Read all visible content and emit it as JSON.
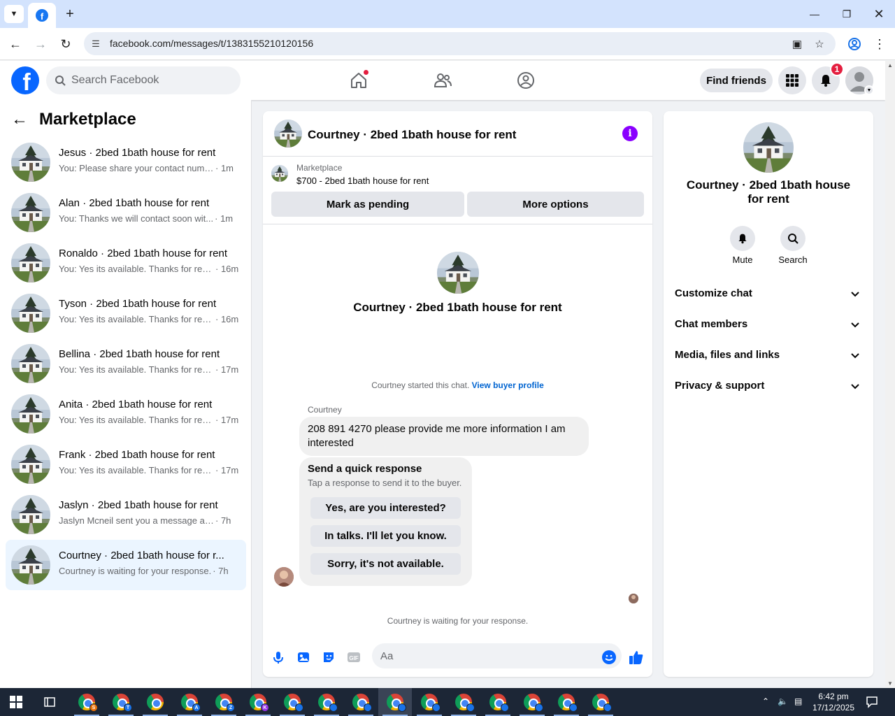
{
  "browser": {
    "url": "facebook.com/messages/t/1383155210120156"
  },
  "header": {
    "search_placeholder": "Search Facebook",
    "find_friends_label": "Find friends",
    "notification_count": "1"
  },
  "sidebar": {
    "title": "Marketplace",
    "conversations": [
      {
        "title": "Jesus · 2bed 1bath house for rent",
        "snippet": "You: Please share your contact numb...",
        "time": "· 1m",
        "active": false
      },
      {
        "title": "Alan · 2bed 1bath house for rent",
        "snippet": "You: Thanks we will contact soon wit...",
        "time": "· 1m",
        "active": false
      },
      {
        "title": "Ronaldo · 2bed 1bath house for rent",
        "snippet": "You: Yes its available. Thanks for rea...",
        "time": "· 16m",
        "active": false
      },
      {
        "title": "Tyson · 2bed 1bath house for rent",
        "snippet": "You: Yes its available. Thanks for rea...",
        "time": "· 16m",
        "active": false
      },
      {
        "title": "Bellina · 2bed 1bath house for rent",
        "snippet": "You: Yes its available. Thanks for rea...",
        "time": "· 17m",
        "active": false
      },
      {
        "title": "Anita · 2bed 1bath house for rent",
        "snippet": "You: Yes its available. Thanks for rea...",
        "time": "· 17m",
        "active": false
      },
      {
        "title": "Frank · 2bed 1bath house for rent",
        "snippet": "You: Yes its available. Thanks for rea...",
        "time": "· 17m",
        "active": false
      },
      {
        "title": "Jaslyn · 2bed 1bath house for rent",
        "snippet": "Jaslyn Mcneil sent you a message abo...",
        "time": "· 7h",
        "active": false
      },
      {
        "title": "Courtney · 2bed 1bath house for r...",
        "snippet": "Courtney is waiting for your response.",
        "time": "· 7h",
        "active": true
      }
    ]
  },
  "chat": {
    "title": "Courtney · 2bed 1bath house for rent",
    "listing_label": "Marketplace",
    "listing_desc": "$700 - 2bed 1bath house for rent",
    "mark_pending_label": "Mark as pending",
    "more_options_label": "More options",
    "intro_name": "Courtney · 2bed 1bath house for rent",
    "started_text": "Courtney started this chat.",
    "view_buyer_label": "View buyer profile",
    "sender_name": "Courtney",
    "message_text": "208 891 4270 please provide me more information I am interested",
    "quick_title": "Send a quick response",
    "quick_subtitle": "Tap a response to send it to the buyer.",
    "quick_options": [
      "Yes, are you interested?",
      "In talks. I'll let you know.",
      "Sorry, it's not available."
    ],
    "waiting_text": "Courtney is waiting for your response.",
    "input_placeholder": "Aa"
  },
  "info_panel": {
    "name": "Courtney · 2bed 1bath house for rent",
    "mute_label": "Mute",
    "search_label": "Search",
    "sections": [
      "Customize chat",
      "Chat members",
      "Media, files and links",
      "Privacy & support"
    ]
  },
  "taskbar": {
    "time": "6:42 pm",
    "date": "17/12/2025",
    "app_badges": [
      {
        "letter": "S",
        "color": "#e8710a"
      },
      {
        "letter": "T",
        "color": "#1a73e8"
      },
      {
        "letter": "",
        "color": ""
      },
      {
        "letter": "A",
        "color": "#1a73e8"
      },
      {
        "letter": "Z",
        "color": "#1a73e8"
      },
      {
        "letter": "K",
        "color": "#9334e6"
      },
      {
        "letter": "",
        "color": "#1a73e8"
      },
      {
        "letter": "",
        "color": "#1a73e8"
      },
      {
        "letter": "",
        "color": "#1a73e8"
      },
      {
        "letter": "",
        "color": "#1a73e8"
      },
      {
        "letter": "",
        "color": "#1a73e8"
      },
      {
        "letter": "",
        "color": "#1a73e8"
      },
      {
        "letter": "",
        "color": "#1a73e8"
      },
      {
        "letter": "",
        "color": "#1a73e8"
      },
      {
        "letter": "",
        "color": "#1a73e8"
      },
      {
        "letter": "",
        "color": "#1a73e8"
      }
    ]
  },
  "colors": {
    "fb_blue": "#0866ff",
    "link_blue": "#0064d1",
    "active_conv_bg": "#ebf5ff",
    "info_purple": "#8a00ff",
    "badge_red": "#e41e3f"
  }
}
